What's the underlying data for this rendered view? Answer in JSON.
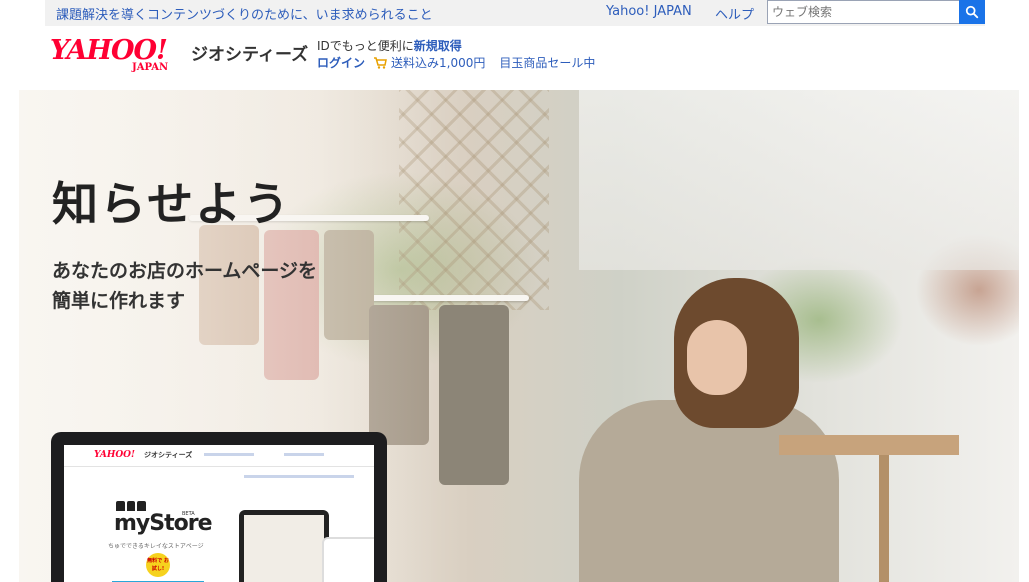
{
  "topbar": {
    "promo": "課題解決を導くコンテンツづくりのために、いま求められること",
    "yahoo_japan": "Yahoo! JAPAN",
    "help": "ヘルプ",
    "search_placeholder": "ウェブ検索"
  },
  "header": {
    "logo_main": "YAHOO!",
    "logo_sub": "JAPAN",
    "service": "ジオシティーズ",
    "id_text": "IDでもっと便利に",
    "signup": "新規取得",
    "login": "ログイン",
    "shipping": "送料込み1,000円",
    "sale": "目玉商品セール中"
  },
  "hero": {
    "headline": "知らせよう",
    "sub_line1": "あなたのお店のホームページを",
    "sub_line2": "簡単に作れます"
  },
  "mockup": {
    "logo": "YAHOO!",
    "service": "ジオシティーズ",
    "product": "myStore",
    "beta": "BETA",
    "tagline": "ちゅでできるキレイなストアページ",
    "badge": "無料で お試し!"
  },
  "colors": {
    "link": "#2d5dbb",
    "brand_red": "#ff0033",
    "search_button": "#1a73e8"
  }
}
